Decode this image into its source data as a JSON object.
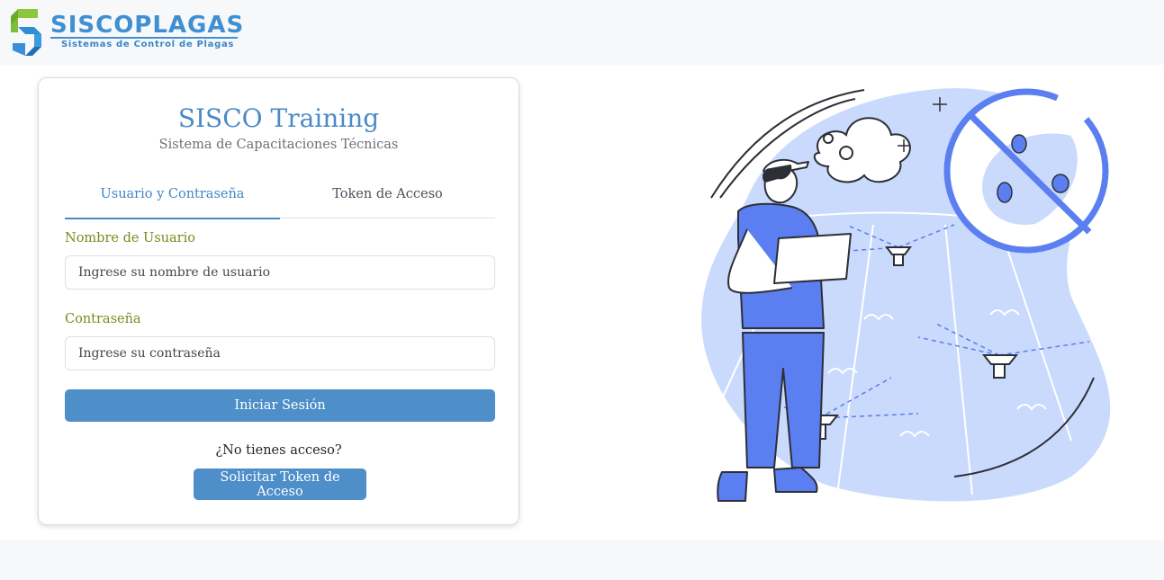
{
  "header": {
    "brand": "SISCOPLAGAS",
    "tagline": "Sistemas de Control de Plagas",
    "logo_icon": "sisco-s-logo-icon"
  },
  "login": {
    "title": "SISCO Training",
    "subtitle": "Sistema de Capacitaciones Técnicas",
    "tabs": [
      {
        "label": "Usuario y Contraseña",
        "active": true
      },
      {
        "label": "Token de Acceso",
        "active": false
      }
    ],
    "username": {
      "label": "Nombre de Usuario",
      "placeholder": "Ingrese su nombre de usuario",
      "value": ""
    },
    "password": {
      "label": "Contraseña",
      "placeholder": "Ingrese su contraseña",
      "value": ""
    },
    "submit_label": "Iniciar Sesión",
    "no_access_text": "¿No tienes acceso?",
    "request_token_label": "Solicitar Token de Acceso"
  },
  "colors": {
    "accent": "#4e8ec9",
    "label_olive": "#7a8a1c",
    "illustration_blue": "#5b7ff0",
    "illustration_light": "#c9dafc"
  },
  "illustration": {
    "icon": "pest-control-worker-illustration"
  }
}
